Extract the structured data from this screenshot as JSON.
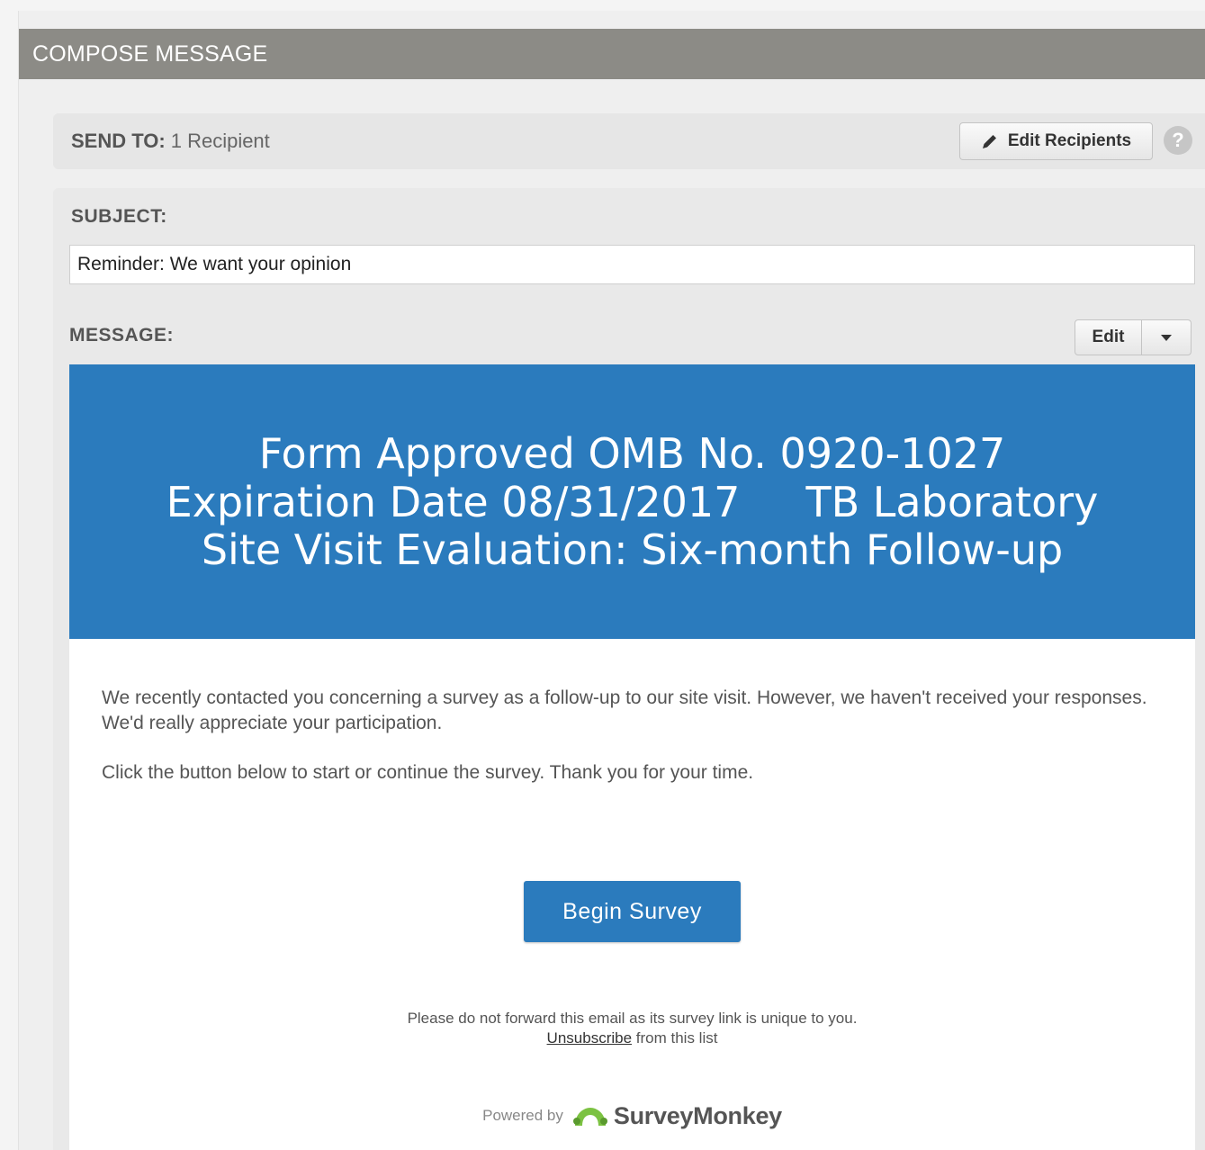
{
  "header": {
    "title": "COMPOSE MESSAGE"
  },
  "send_to": {
    "label": "SEND TO:",
    "value": "1 Recipient",
    "edit_button": "Edit Recipients",
    "help": "?"
  },
  "subject": {
    "label": "SUBJECT:",
    "value": "Reminder: We want your opinion"
  },
  "message": {
    "label": "MESSAGE:",
    "edit_button": "Edit",
    "banner": {
      "line1": "Form Approved OMB No. 0920-1027",
      "line2": "Expiration Date 08/31/2017     TB Laboratory",
      "line3": "Site Visit Evaluation: Six-month Follow-up"
    },
    "paragraph1": "We recently contacted you concerning a survey as a follow-up to our site visit. However, we haven't received your responses. We'd really appreciate your participation.",
    "paragraph2": "Click the button below to start or continue the survey. Thank you for your time.",
    "begin_button": "Begin Survey",
    "footer_note": "Please do not forward this email as its survey link is unique to you.",
    "unsubscribe_link": "Unsubscribe",
    "unsubscribe_suffix": " from this list",
    "powered_by": "Powered by",
    "brand": "SurveyMonkey"
  },
  "colors": {
    "header_bg": "#8c8b86",
    "banner_bg": "#2b7bbd",
    "button_bg": "#2b7bbd",
    "logo_green": "#7cc242"
  }
}
